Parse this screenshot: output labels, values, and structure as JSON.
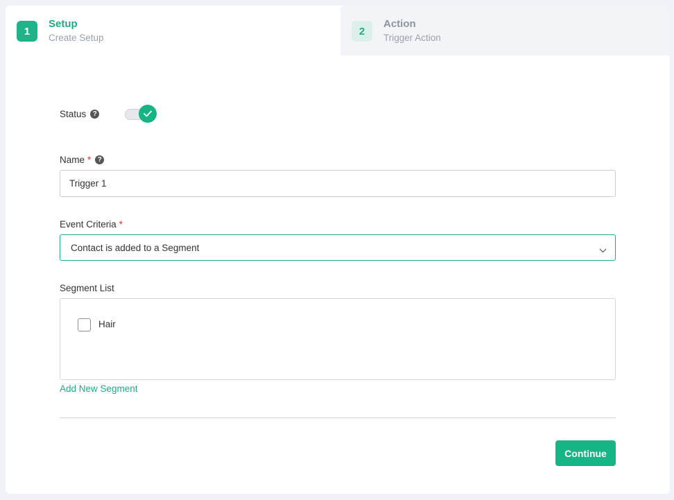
{
  "steps": [
    {
      "number": "1",
      "title": "Setup",
      "subtitle": "Create Setup"
    },
    {
      "number": "2",
      "title": "Action",
      "subtitle": "Trigger Action"
    }
  ],
  "form": {
    "status": {
      "label": "Status",
      "help": "?",
      "enabled": true
    },
    "name": {
      "label": "Name",
      "required_mark": "*",
      "help": "?",
      "value": "Trigger 1"
    },
    "event_criteria": {
      "label": "Event Criteria",
      "required_mark": "*",
      "selected": "Contact is added to a Segment"
    },
    "segment_list": {
      "label": "Segment List",
      "items": [
        {
          "label": "Hair",
          "checked": false
        }
      ]
    },
    "add_segment_link": "Add New Segment",
    "continue_label": "Continue"
  },
  "colors": {
    "accent": "#17b585",
    "accent_text": "#1fa888",
    "required": "#e53935"
  },
  "icons": {
    "status_help": "question-circle-icon",
    "name_help": "question-circle-icon",
    "select_caret": "chevron-down-icon",
    "toggle_check": "check-icon"
  }
}
